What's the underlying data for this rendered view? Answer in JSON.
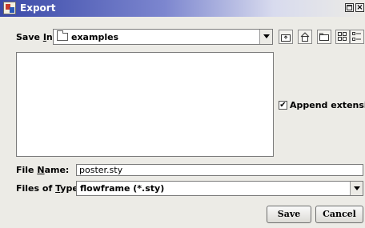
{
  "window": {
    "title": "Export"
  },
  "save_in": {
    "label_pre": "Save ",
    "label_key": "I",
    "label_post": "n:",
    "value": "examples"
  },
  "toolbar": {
    "icons": [
      "up-one-level-icon",
      "home-icon",
      "new-folder-icon",
      "list-view-icon",
      "details-view-icon"
    ]
  },
  "append_extension": {
    "label": "Append extension",
    "checked": true,
    "check_glyph": "✔"
  },
  "file_name": {
    "label_pre": "File ",
    "label_key": "N",
    "label_post": "ame:",
    "value": "poster.sty"
  },
  "file_type": {
    "label_pre": "Files of ",
    "label_key": "T",
    "label_post": "ype:",
    "value": "flowframe (*.sty)"
  },
  "buttons": {
    "save": "Save",
    "cancel": "Cancel"
  },
  "window_controls": {
    "close_glyph": "×"
  }
}
